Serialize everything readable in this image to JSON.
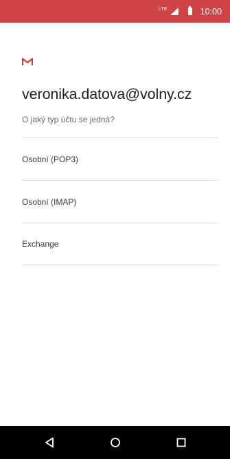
{
  "status_bar": {
    "network": "LTE",
    "time": "10:00",
    "background_color": "#cf4545"
  },
  "header": {
    "logo_icon": "gmail-m-icon",
    "email": "veronika.datova@volny.cz",
    "question": "O jaký typ účtu se jedná?"
  },
  "options": [
    {
      "label": "Osobní (POP3)"
    },
    {
      "label": "Osobní (IMAP)"
    },
    {
      "label": "Exchange"
    }
  ],
  "nav_bar": {
    "back_icon": "back-triangle-icon",
    "home_icon": "home-circle-icon",
    "recents_icon": "recents-square-icon"
  }
}
